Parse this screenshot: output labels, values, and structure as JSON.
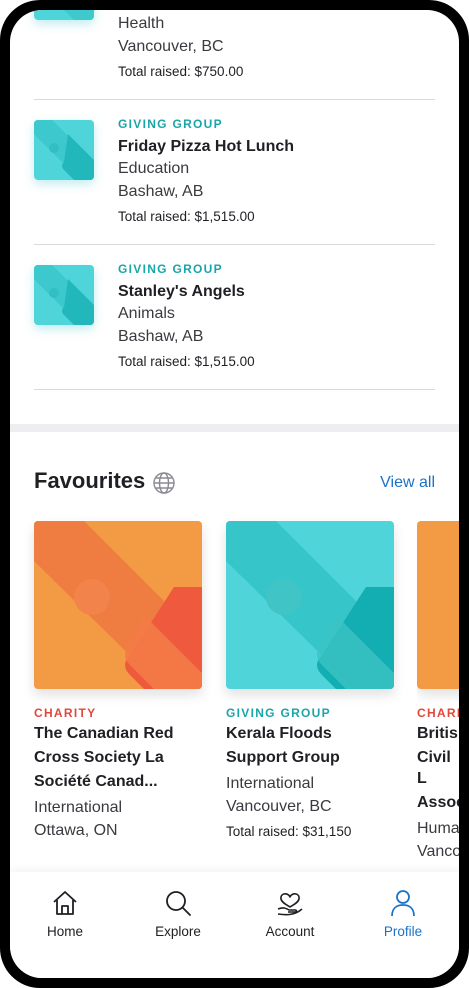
{
  "giving_list": [
    {
      "tag": "",
      "title": "",
      "category": "Health",
      "location": "Vancouver, BC",
      "total": "Total raised: $750.00"
    },
    {
      "tag": "GIVING GROUP",
      "title": "Friday Pizza Hot Lunch",
      "category": "Education",
      "location": "Bashaw, AB",
      "total": "Total raised: $1,515.00"
    },
    {
      "tag": "GIVING GROUP",
      "title": "Stanley's Angels",
      "category": "Animals",
      "location": "Bashaw, AB",
      "total": "Total raised: $1,515.00"
    }
  ],
  "favourites": {
    "title": "Favourites",
    "view_all": "View all",
    "globe_icon": "globe-icon",
    "cards": [
      {
        "tag": "CHARITY",
        "title_line1": "The Canadian Red",
        "title_line2": "Cross Society La",
        "title_line3": "Société Canad...",
        "line1": "International",
        "line2": "Ottawa, ON",
        "total": ""
      },
      {
        "tag": "GIVING GROUP",
        "title_line1": "Kerala Floods",
        "title_line2": "Support Group",
        "title_line3": "",
        "line1": "International",
        "line2": "Vancouver, BC",
        "total": "Total raised: $31,150"
      },
      {
        "tag": "CHARI",
        "title_line1": "British",
        "title_line2": "Civil L",
        "title_line3": "Assoc",
        "line1": "Huma",
        "line2": "Vanco",
        "total": ""
      }
    ]
  },
  "tabbar": {
    "home": "Home",
    "explore": "Explore",
    "account": "Account",
    "profile": "Profile"
  },
  "colors": {
    "teal": "#4fd5d9",
    "teal_dark": "#13aeb1",
    "orange": "#f29a44",
    "red": "#ef5a3e",
    "accent_blue": "#1a73c8"
  }
}
